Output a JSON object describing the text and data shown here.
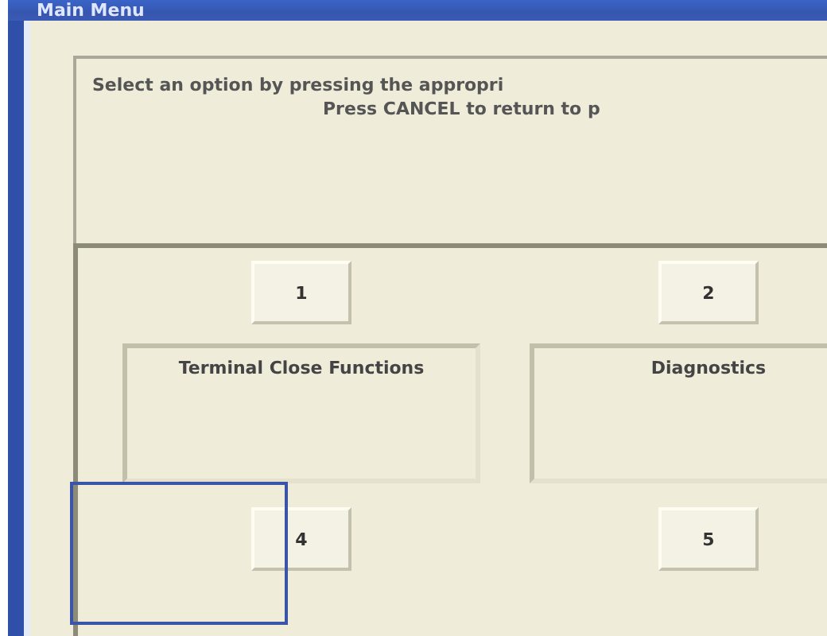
{
  "window": {
    "title": "Main Menu"
  },
  "instructions": [
    "Select an option by pressing the appropri",
    "Press CANCEL to return to p"
  ],
  "options": [
    {
      "number": "1",
      "label": "Terminal Close Functions"
    },
    {
      "number": "2",
      "label": "Diagnostics"
    }
  ],
  "lower_buttons": [
    "4",
    "5"
  ]
}
